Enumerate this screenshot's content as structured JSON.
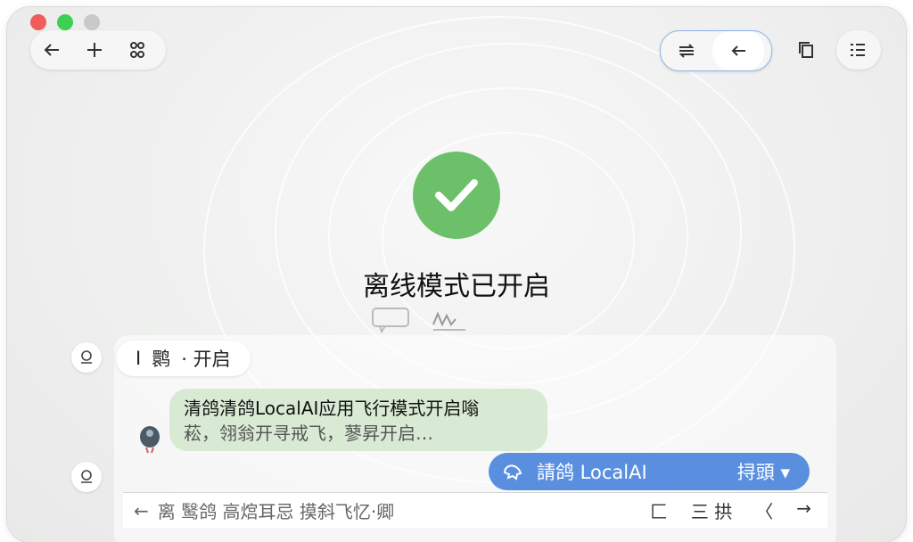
{
  "toolbar": {
    "left_icons": [
      "back-arrow-icon",
      "plus-icon",
      "network-icon"
    ],
    "right_icons": [
      "swap-icon",
      "back-icon",
      "copy-icon",
      "list-icon"
    ]
  },
  "status": {
    "title": "离线模式已开启"
  },
  "chat": {
    "status_pill_text_left": "I",
    "status_pill_text_mid": "鹮",
    "status_pill_text_right": "· 开启",
    "bubble_line1": "清鸽清鸽LocalAI应用飞行模式开启嗡",
    "bubble_line2": "菘，翎翁开寻戒飞，蓼昇开启…",
    "blue_pill_name": "請鸽 LocalAI",
    "blue_pill_action": "挦頭 ▾"
  },
  "input": {
    "placeholder": "离 鹥鸽  高熍耳忌 摸斜飞忆·卿",
    "right_labels": [
      "匚",
      "三 拱",
      "〈",
      "→"
    ]
  },
  "colors": {
    "check_green": "#6cc06a",
    "bubble_green": "#d8ead3",
    "accent_blue": "#5a8fe0"
  }
}
